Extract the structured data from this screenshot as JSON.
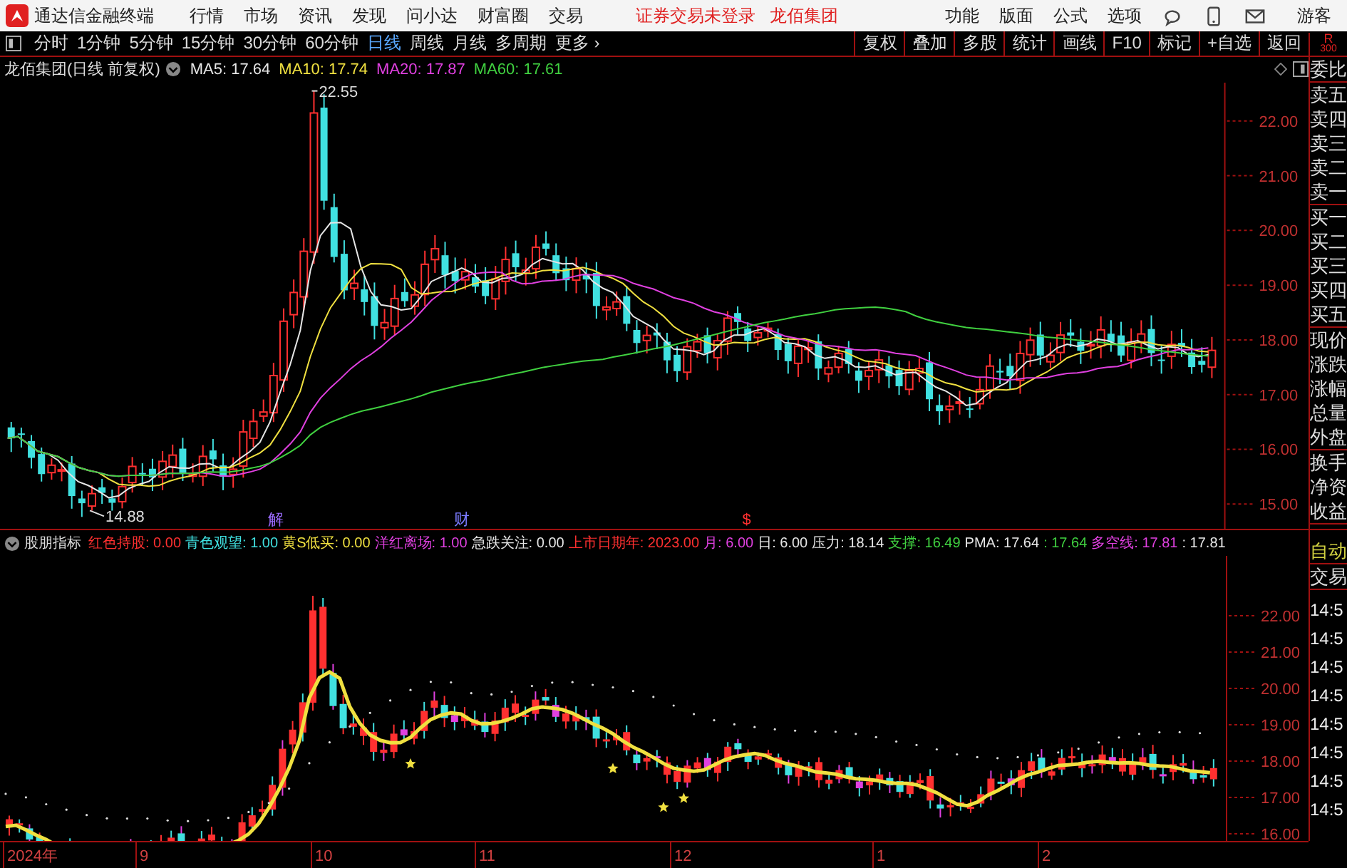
{
  "app_bar": {
    "title": "通达信金融终端",
    "menu": [
      "行情",
      "市场",
      "资讯",
      "发现",
      "问小达",
      "财富圈",
      "交易"
    ],
    "status": "证券交易未登录",
    "stock": "龙佰集团",
    "right_menu": [
      "功能",
      "版面",
      "公式",
      "选项"
    ],
    "user": "游客"
  },
  "toolbar": {
    "periods": [
      {
        "label": "分时",
        "selected": false
      },
      {
        "label": "1分钟",
        "selected": false
      },
      {
        "label": "5分钟",
        "selected": false
      },
      {
        "label": "15分钟",
        "selected": false
      },
      {
        "label": "30分钟",
        "selected": false
      },
      {
        "label": "60分钟",
        "selected": false
      },
      {
        "label": "日线",
        "selected": true
      },
      {
        "label": "周线",
        "selected": false
      },
      {
        "label": "月线",
        "selected": false
      },
      {
        "label": "多周期",
        "selected": false
      },
      {
        "label": "更多 ›",
        "selected": false
      }
    ],
    "buttons": [
      "复权",
      "叠加",
      "多股",
      "统计",
      "画线",
      "F10",
      "标记",
      "+自选",
      "返回"
    ],
    "badge": [
      "R",
      "300"
    ]
  },
  "main_chart": {
    "title": "龙佰集团(日线 前复权)",
    "ma": [
      {
        "label": "MA5: 17.64",
        "color": "#e6e6e6"
      },
      {
        "label": "MA10: 17.74",
        "color": "#f0e040"
      },
      {
        "label": "MA20: 17.87",
        "color": "#e040e0"
      },
      {
        "label": "MA60: 17.61",
        "color": "#40d040"
      }
    ],
    "annotations": [
      "22.55",
      "14.88"
    ],
    "events": [
      {
        "label": "解",
        "color": "#9b6bff"
      },
      {
        "label": "财",
        "color": "#7b7bff"
      },
      {
        "label": "$",
        "color": "#ff3030"
      }
    ],
    "yticks": [
      "22.00",
      "21.00",
      "20.00",
      "19.00",
      "18.00",
      "17.00",
      "16.00",
      "15.00"
    ]
  },
  "quote_panel": {
    "groups": [
      [
        "委比"
      ],
      [
        "卖五",
        "卖四",
        "卖三",
        "卖二",
        "卖一"
      ],
      [
        "买一",
        "买二",
        "买三",
        "买四",
        "买五"
      ],
      [
        "现价",
        "涨跌",
        "涨幅",
        "总量",
        "外盘"
      ],
      [
        "换手",
        "净资",
        "收益"
      ]
    ]
  },
  "indicator": {
    "name": "股朋指标",
    "items": [
      {
        "text": "红色持股: 0.00",
        "color": "#ff3030"
      },
      {
        "text": "青色观望: 1.00",
        "color": "#40e0e0"
      },
      {
        "text": "黄S低买: 0.00",
        "color": "#f0e040"
      },
      {
        "text": "洋红离场: 1.00",
        "color": "#e040e0"
      },
      {
        "text": "急跌关注: 0.00",
        "color": "#e6e6e6"
      },
      {
        "text": "上市日期年: 2023.00",
        "color": "#ff3030"
      },
      {
        "text": "月: 6.00",
        "color": "#e040e0"
      },
      {
        "text": "日: 6.00",
        "color": "#e6e6e6"
      },
      {
        "text": "压力: 18.14",
        "color": "#e6e6e6"
      },
      {
        "text": "支撑: 16.49",
        "color": "#40d040"
      },
      {
        "text": "PMA: 17.64",
        "color": "#e6e6e6"
      },
      {
        "text": ": 17.64",
        "color": "#40d040"
      },
      {
        "text": "多空线: 17.81",
        "color": "#e040e0"
      },
      {
        "text": ": 17.81",
        "color": "#e6e6e6"
      }
    ],
    "yticks": [
      "22.00",
      "21.00",
      "20.00",
      "19.00",
      "18.00",
      "17.00",
      "16.00"
    ]
  },
  "trade_panel": {
    "mode": "自动",
    "title": "交易",
    "times": [
      "14:5",
      "14:5",
      "14:5",
      "14:5",
      "14:5",
      "14:5",
      "14:5",
      "14:5"
    ]
  },
  "time_axis": [
    "2024年",
    "9",
    "10",
    "11",
    "12",
    "1",
    "2"
  ]
}
